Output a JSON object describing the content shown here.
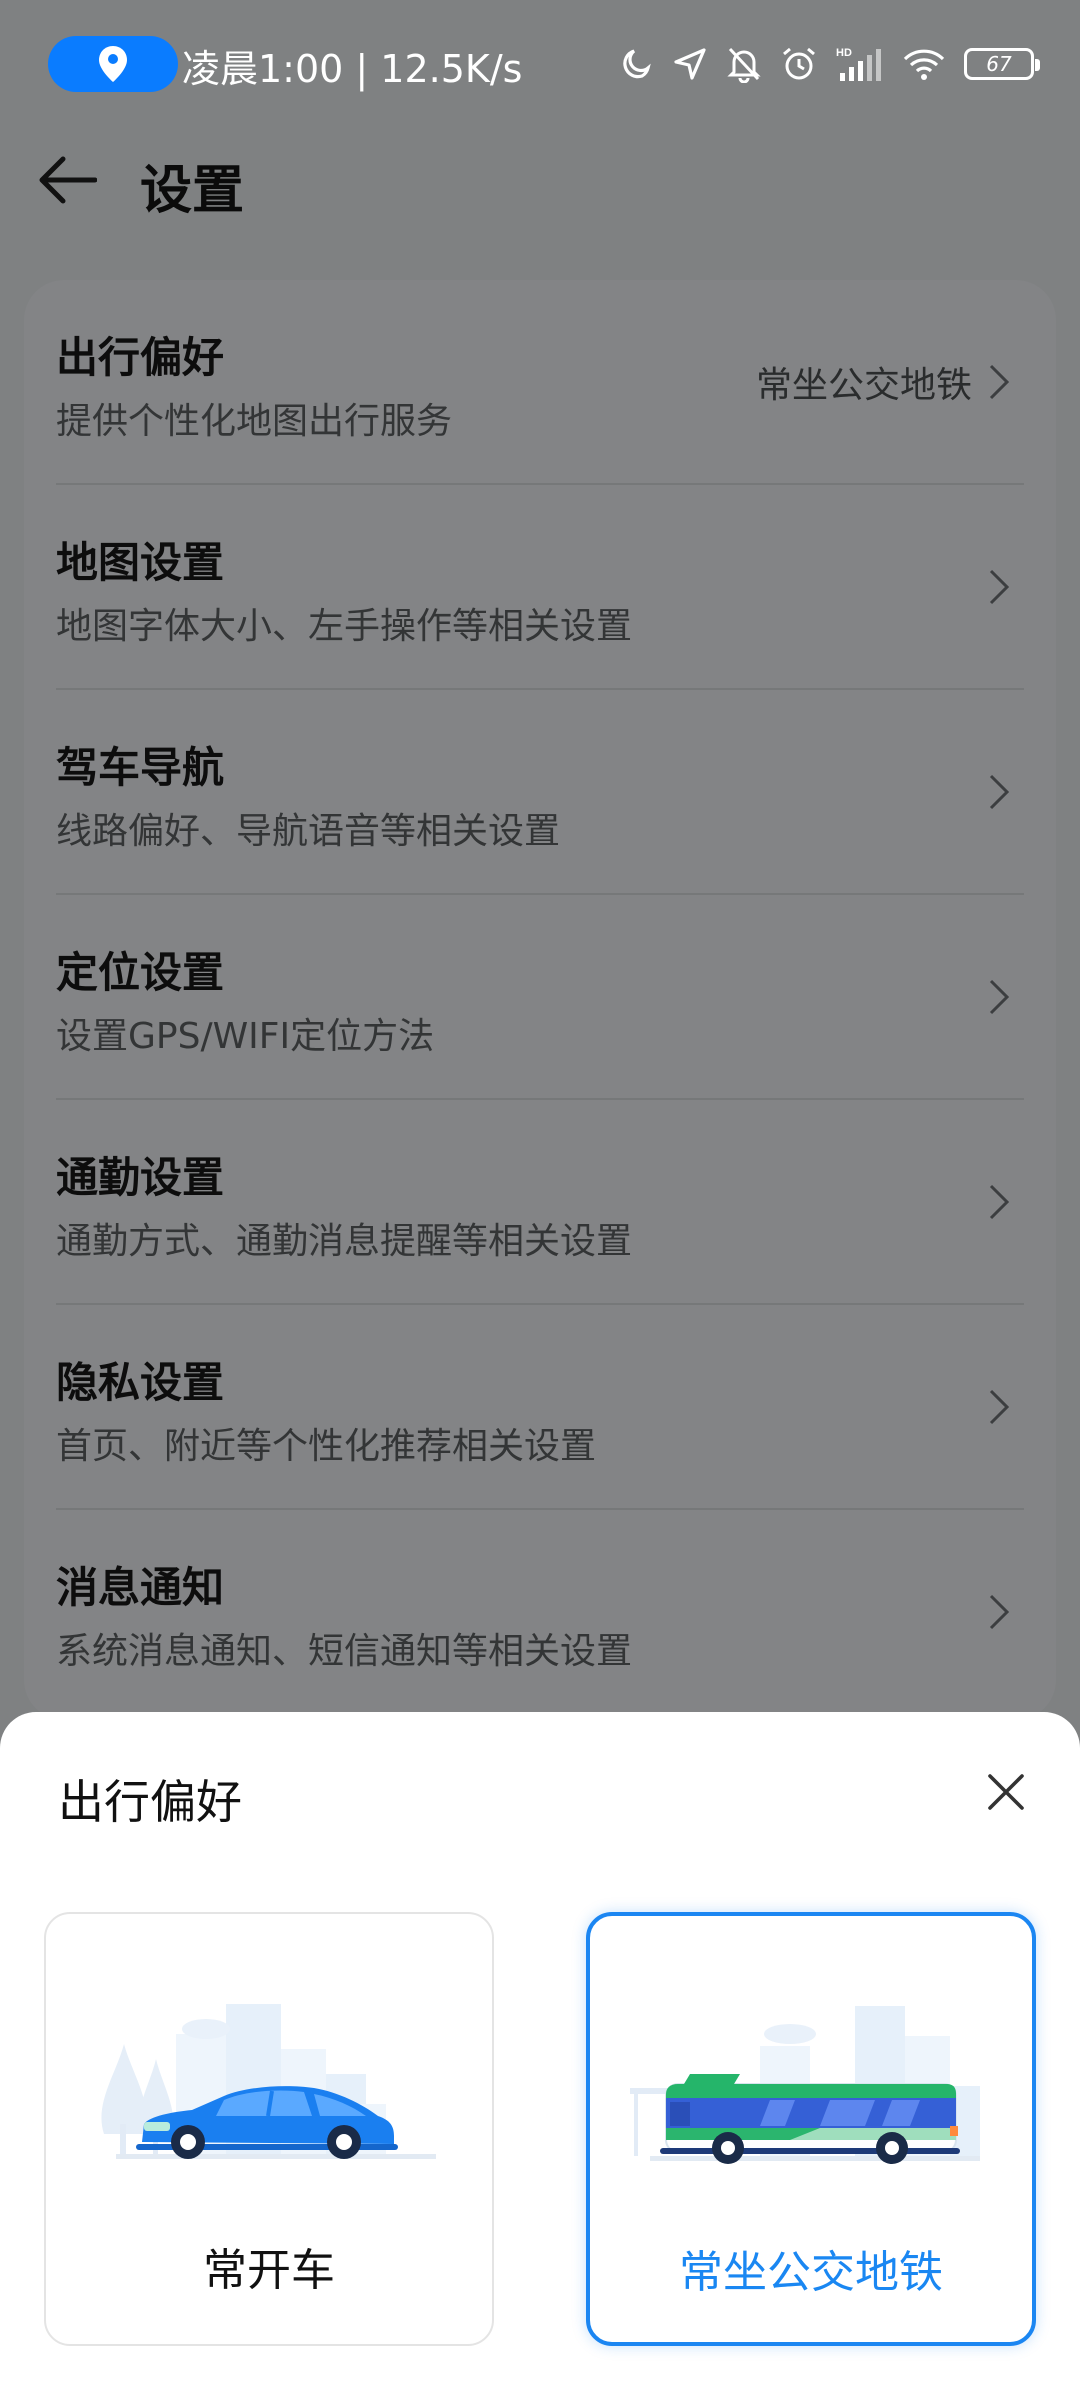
{
  "status_bar": {
    "text": "凌晨1:00 | 12.5K/s",
    "battery_level": "67",
    "icons": [
      "location-icon",
      "moon-icon",
      "navigation-arrow-icon",
      "bell-mute-icon",
      "alarm-icon",
      "signal-icon",
      "wifi-icon",
      "battery-icon"
    ]
  },
  "header": {
    "title": "设置"
  },
  "settings": {
    "items": [
      {
        "title": "出行偏好",
        "desc": "提供个性化地图出行服务",
        "value": "常坐公交地铁"
      },
      {
        "title": "地图设置",
        "desc": "地图字体大小、左手操作等相关设置",
        "value": ""
      },
      {
        "title": "驾车导航",
        "desc": "线路偏好、导航语音等相关设置",
        "value": ""
      },
      {
        "title": "定位设置",
        "desc": "设置GPS/WIFI定位方法",
        "value": ""
      },
      {
        "title": "通勤设置",
        "desc": "通勤方式、通勤消息提醒等相关设置",
        "value": ""
      },
      {
        "title": "隐私设置",
        "desc": "首页、附近等个性化推荐相关设置",
        "value": ""
      },
      {
        "title": "消息通知",
        "desc": "系统消息通知、短信通知等相关设置",
        "value": ""
      }
    ]
  },
  "sheet": {
    "title": "出行偏好",
    "options": [
      {
        "label": "常开车",
        "selected": false,
        "icon": "car-illustration"
      },
      {
        "label": "常坐公交地铁",
        "selected": true,
        "icon": "bus-illustration"
      }
    ]
  },
  "colors": {
    "accent": "#1a87f2",
    "scrim": "#7f8182",
    "location_pill": "#0a7cff"
  }
}
